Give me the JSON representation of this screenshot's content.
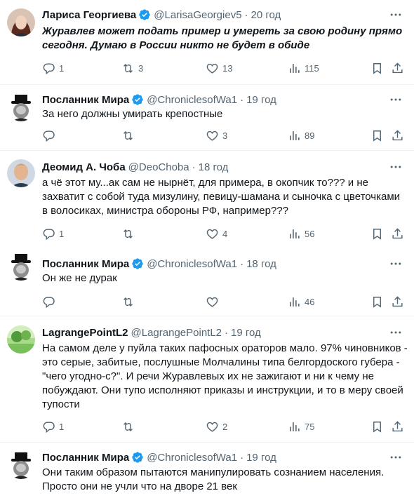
{
  "tweets": [
    {
      "name": "Лариса Георгиева",
      "handle": "@LarisaGeorgiev5",
      "time": "20 год",
      "text": "Журавлев может подать пример и умереть за свою родину прямо сегодня. Думаю в России никто не будет в обиде",
      "replies": "1",
      "retweets": "3",
      "likes": "13",
      "views": "115",
      "avatar": "woman-avatar",
      "verified": true
    },
    {
      "name": "Посланник Мира",
      "handle": "@ChroniclesofWa1",
      "time": "19 год",
      "text": "За него должны умирать крепостные",
      "replies": "",
      "retweets": "",
      "likes": "3",
      "views": "89",
      "avatar": "churchill-avatar",
      "verified": true
    },
    {
      "name": "Деомид А. Чоба",
      "handle": "@DeoChoba",
      "time": "18 год",
      "text": "а чё этот му...ак сам не нырнёт, для примера, в окопчик то??? и не захватит с собой туда мизулину, певицу-шамана и сыночка с цветочками в волосиках, министра обороны РФ, например???",
      "replies": "1",
      "retweets": "",
      "likes": "4",
      "views": "56",
      "avatar": "man-avatar",
      "verified": false
    },
    {
      "name": "Посланник Мира",
      "handle": "@ChroniclesofWa1",
      "time": "18 год",
      "text": "Он же не дурак",
      "replies": "",
      "retweets": "",
      "likes": "",
      "views": "46",
      "avatar": "churchill-avatar",
      "verified": true
    },
    {
      "name": "LagrangePointL2",
      "handle": "@LagrangePointL2",
      "time": "19 год",
      "text": "На самом деле у пуйла таких пафосных ораторов мало. 97% чиновников - это серые, забитые, послушные Молчалины типа белгордоского губера - \"чего угодно-с?\". И речи Журавлевых их не зажигают и ни к чему не побуждают. Они тупо исполняют приказы и инструкции, и то в меру своей тупости",
      "replies": "1",
      "retweets": "",
      "likes": "2",
      "views": "75",
      "avatar": "landscape-avatar",
      "verified": false
    },
    {
      "name": "Посланник Мира",
      "handle": "@ChroniclesofWa1",
      "time": "19 год",
      "text": "Они таким образом пытаются манипулировать сознанием населения. Просто они не учли что на дворе 21 век",
      "replies": "",
      "retweets": "",
      "likes": "",
      "views": "",
      "avatar": "churchill-avatar",
      "verified": true
    }
  ],
  "colors": {
    "verified": "#1d9bf0",
    "muted": "#536471",
    "text": "#0f1419",
    "divider": "#eff3f4"
  }
}
